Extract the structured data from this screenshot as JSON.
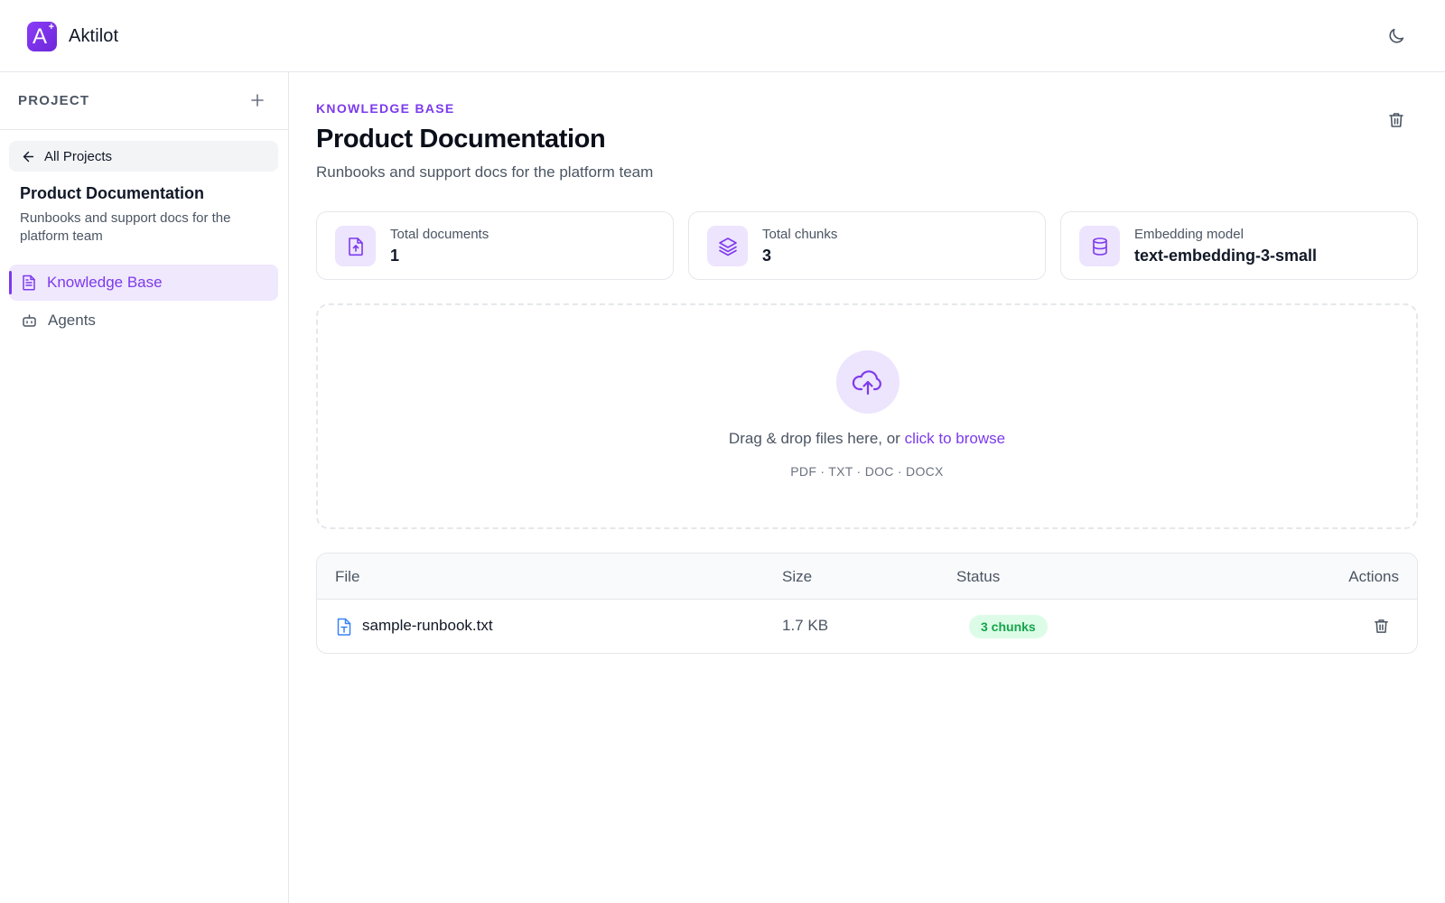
{
  "app": {
    "name": "Aktilot",
    "logo_letter": "A",
    "logo_plus": "+"
  },
  "colors": {
    "accent": "#7c3aed",
    "accent_soft": "#ede4fd",
    "success": "#16a34a",
    "success_bg": "#dcfce7"
  },
  "icons": {
    "theme": "moon-icon",
    "add": "plus-icon",
    "back": "arrow-left-icon",
    "knowledge_base": "document-icon",
    "agents": "bot-icon",
    "delete": "trash-icon",
    "documents": "file-upload-icon",
    "chunks": "layers-icon",
    "model": "database-icon",
    "upload": "cloud-upload-icon",
    "file": "file-text-icon"
  },
  "sidebar": {
    "section_label": "PROJECT",
    "back_label": "All Projects",
    "project_title": "Product Documentation",
    "project_description": "Runbooks and support docs for the platform team",
    "nav": [
      {
        "label": "Knowledge Base",
        "active": true
      },
      {
        "label": "Agents",
        "active": false
      }
    ]
  },
  "main": {
    "eyebrow": "KNOWLEDGE BASE",
    "title": "Product Documentation",
    "description": "Runbooks and support docs for the platform team",
    "stats": [
      {
        "label": "Total documents",
        "value": "1"
      },
      {
        "label": "Total chunks",
        "value": "3"
      },
      {
        "label": "Embedding model",
        "value": "text-embedding-3-small"
      }
    ],
    "dropzone": {
      "text": "Drag & drop files here, or ",
      "link": "click to browse",
      "types": "PDF · TXT · DOC · DOCX"
    },
    "table": {
      "headers": {
        "file": "File",
        "size": "Size",
        "status": "Status",
        "actions": "Actions"
      },
      "rows": [
        {
          "file": "sample-runbook.txt",
          "size": "1.7 KB",
          "status": "3 chunks"
        }
      ]
    }
  }
}
